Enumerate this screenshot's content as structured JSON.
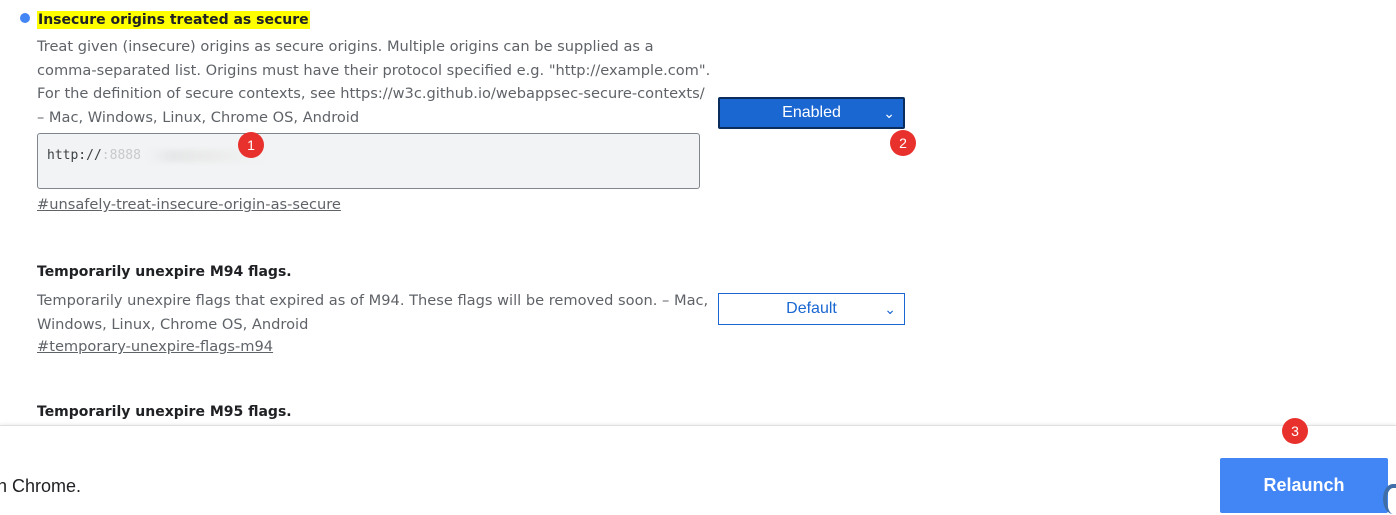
{
  "experiments": [
    {
      "title": "Insecure origins treated as secure",
      "description_lines": [
        "Treat given (insecure) origins as secure origins. Multiple origins can be supplied as a",
        "comma-separated list. Origins must have their protocol specified e.g. \"http://example.com\".",
        "For the definition of secure contexts, see https://w3c.github.io/webappsec-secure-contexts/",
        "– Mac, Windows, Linux, Chrome OS, Android"
      ],
      "textarea_value": "http://",
      "textarea_value_tail": ":8888",
      "permalink": "#unsafely-treat-insecure-origin-as-secure",
      "select_value": "Enabled"
    },
    {
      "title": "Temporarily unexpire M94 flags.",
      "description_lines": [
        "Temporarily unexpire flags that expired as of M94. These flags will be removed soon. – Mac,",
        "Windows, Linux, Chrome OS, Android"
      ],
      "permalink": "#temporary-unexpire-flags-m94",
      "select_value": "Default"
    },
    {
      "title": "Temporarily unexpire M95 flags."
    }
  ],
  "annotations": [
    "1",
    "2",
    "3"
  ],
  "bottom_bar": {
    "message": "nch Chrome.",
    "relaunch_label": "Relaunch"
  },
  "icons": {
    "dropdown": "chevron-down-icon",
    "status": "blue-dot-icon"
  },
  "colors": {
    "accent": "#1a67d2",
    "highlight": "#ffff00",
    "badge": "#e8312c",
    "relaunch": "#4285f4"
  }
}
